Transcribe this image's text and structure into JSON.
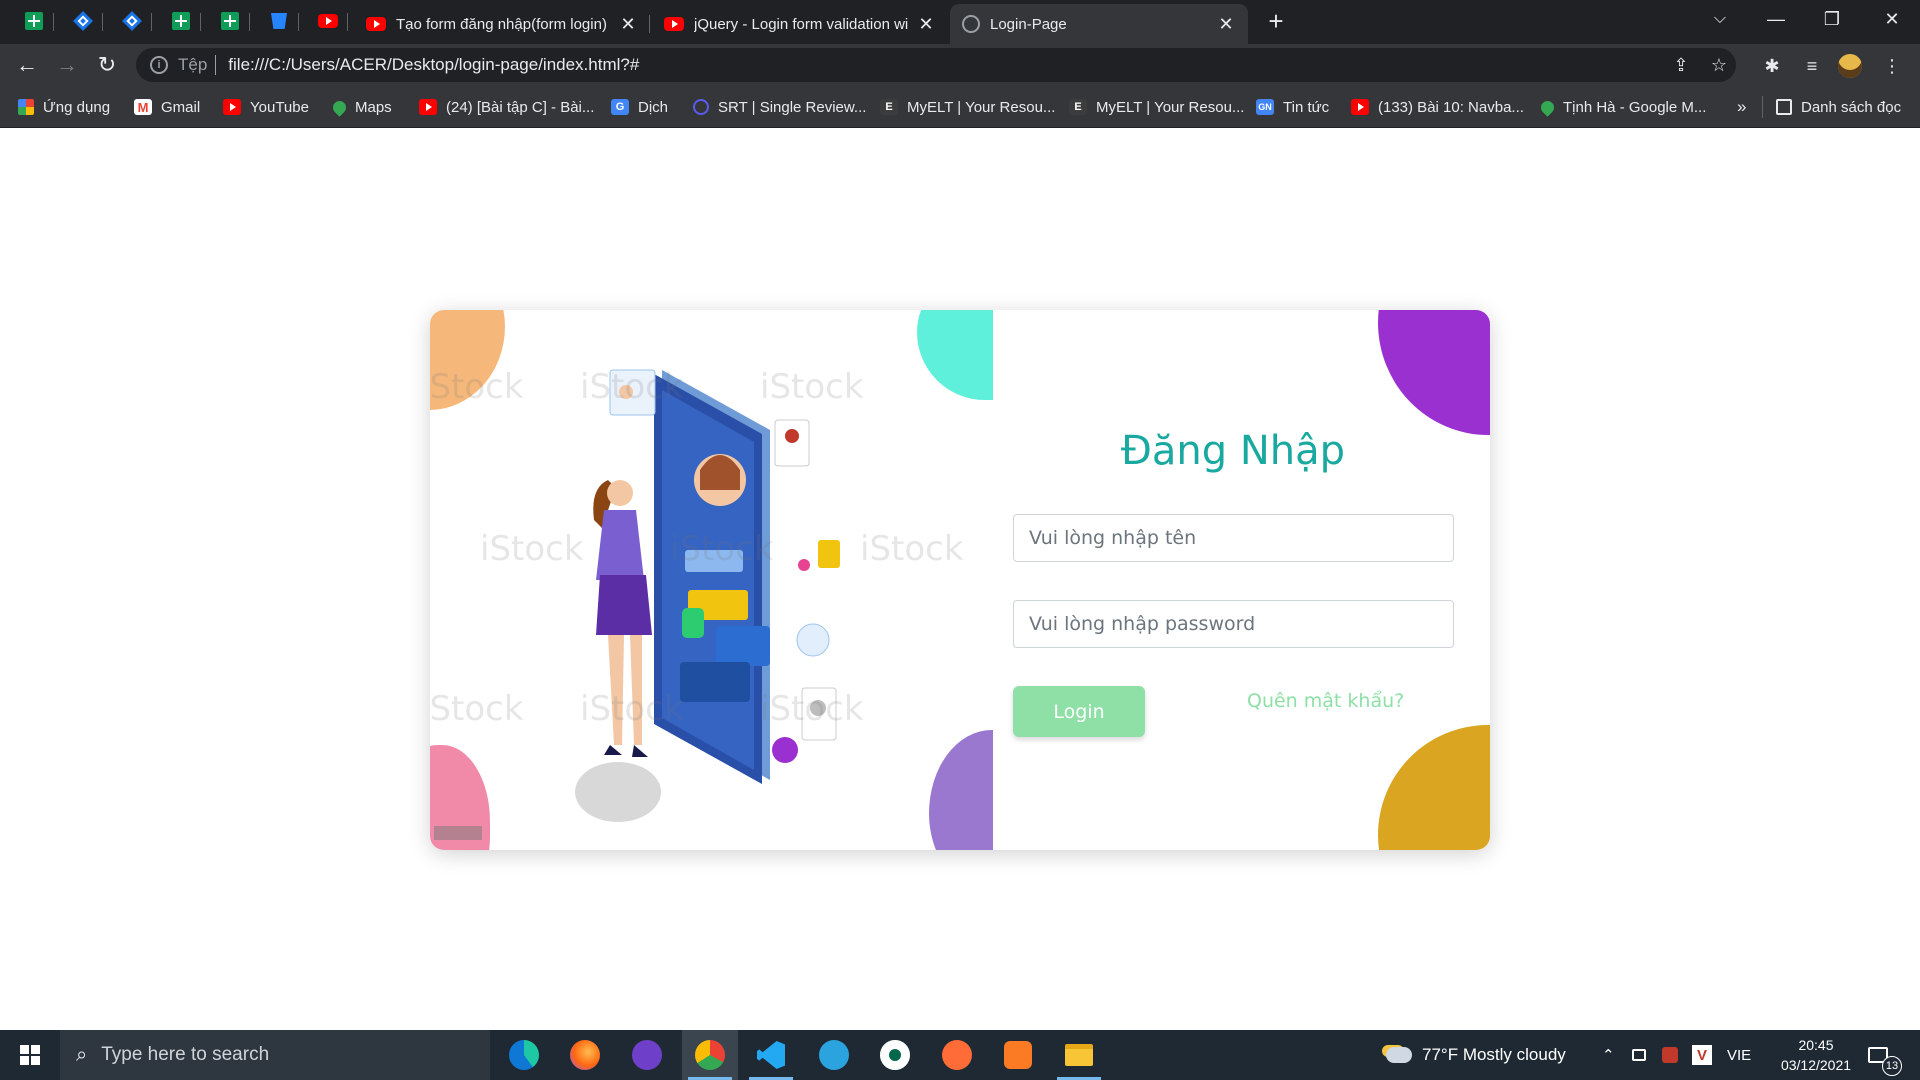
{
  "browser": {
    "tabs": [
      {
        "title": "Tạo form đăng nhập(form login)",
        "icon": "youtube-icon"
      },
      {
        "title": "jQuery - Login form validation wi",
        "icon": "youtube-icon"
      },
      {
        "title": "Login-Page",
        "icon": "globe-icon",
        "active": true
      }
    ],
    "address": {
      "scheme_label": "Tệp",
      "url": "file:///C:/Users/ACER/Desktop/login-page/index.html?#"
    },
    "bookmarks": [
      {
        "label": "Ứng dụng",
        "icon": "apps-grid-icon"
      },
      {
        "label": "Gmail",
        "icon": "gmail-icon"
      },
      {
        "label": "YouTube",
        "icon": "youtube-icon"
      },
      {
        "label": "Maps",
        "icon": "maps-pin-icon"
      },
      {
        "label": "(24) [Bài tập C] - Bài...",
        "icon": "youtube-icon"
      },
      {
        "label": "Dịch",
        "icon": "translate-icon"
      },
      {
        "label": "SRT | Single Review...",
        "icon": "srt-icon"
      },
      {
        "label": "MyELT | Your Resou...",
        "icon": "myelt-icon"
      },
      {
        "label": "MyELT | Your Resou...",
        "icon": "myelt-icon"
      },
      {
        "label": "Tin tức",
        "icon": "news-icon"
      },
      {
        "label": "(133) Bài 10: Navba...",
        "icon": "youtube-icon"
      },
      {
        "label": "Tịnh Hà - Google M...",
        "icon": "maps-pin-icon"
      }
    ],
    "overflow_label": "»",
    "reading_list_label": "Danh sách đọc"
  },
  "login": {
    "title": "Đăng Nhập",
    "username_placeholder": "Vui lòng nhập tên",
    "password_placeholder": "Vui lòng nhập password",
    "login_button": "Login",
    "forgot_link": "Quên mật khẩu?"
  },
  "taskbar": {
    "search_placeholder": "Type here to search",
    "weather": "77°F  Mostly cloudy",
    "language": "VIE",
    "time": "20:45",
    "date": "03/12/2021",
    "notification_count": "13"
  },
  "colors": {
    "title_teal": "#1aa9a0",
    "button_green": "#8ee0a6",
    "blob_purple": "#9b30d0",
    "blob_gold": "#daa520",
    "blob_orange": "#f5b87a",
    "blob_aqua": "#5ff0dc",
    "blob_pink": "#f08aa8",
    "blob_lavender": "#9b78d0"
  }
}
